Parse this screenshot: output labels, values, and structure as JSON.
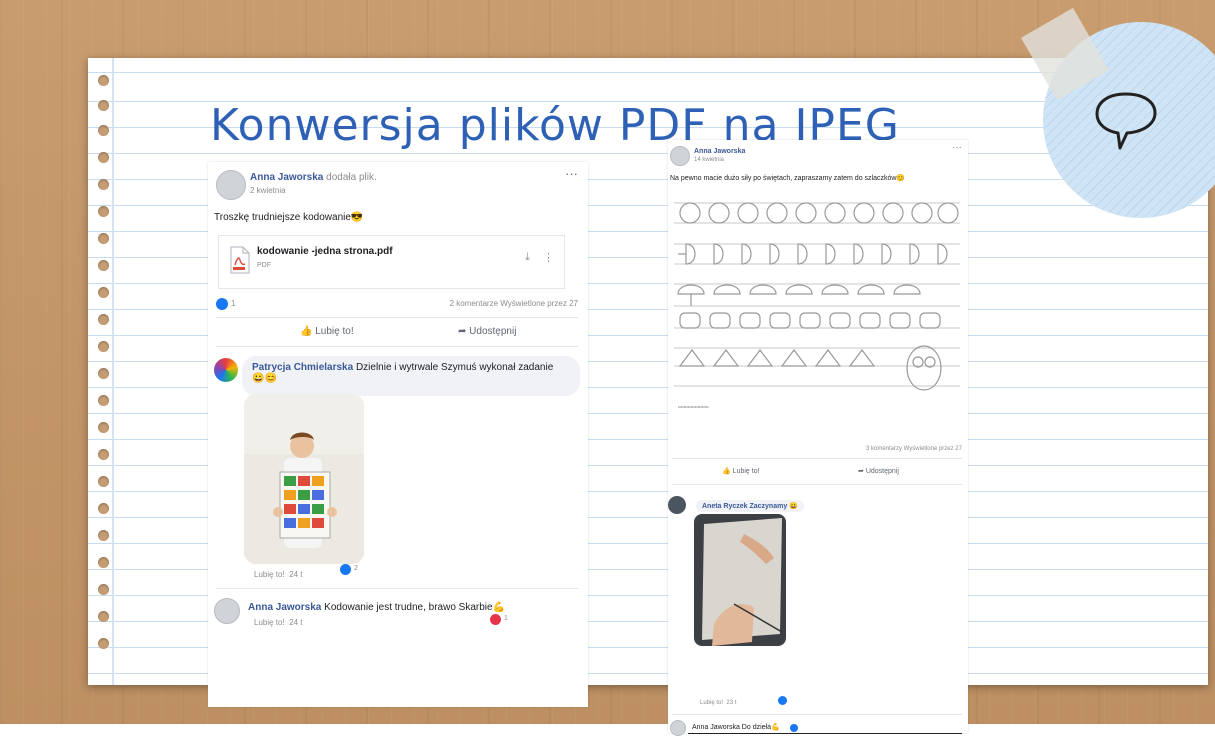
{
  "title": "Konwersja plików PDF na JPEG",
  "left_post": {
    "author": "Anna Jaworska",
    "action": "dodała plik.",
    "date": "2 kwietnia",
    "text": "Troszkę trudniejsze kodowanie😎",
    "file_name": "kodowanie -jedna strona.pdf",
    "file_type": "PDF",
    "reactions_count": "1",
    "stats": "2 komentarze  Wyświetlone przez 27",
    "like_label": "Lubię to!",
    "share_label": "Udostępnij",
    "comment1_author": "Patrycja Chmielarska",
    "comment1_text": "Dzielnie i wytrwale Szymuś wykonał zadanie",
    "comment1_emoji": "😀😊",
    "comment1_like": "Lubię to!",
    "comment1_time": "24 t",
    "comment1_reactions": "2",
    "comment2_author": "Anna Jaworska",
    "comment2_text": "Kodowanie jest trudne, brawo Skarbie💪",
    "comment2_like": "Lubię to!",
    "comment2_time": "24 t",
    "comment2_reactions": "1"
  },
  "right_post": {
    "author": "Anna Jaworska",
    "date": "14 kwietnia",
    "text": "Na pewno macie dużo siły po świętach, zapraszamy zatem do szlaczków😊",
    "stats": "3 komentarzy  Wyświetlone przez 27",
    "like_label": "Lubię to!",
    "share_label": "Udostępnij",
    "comment1_author": "Aneta Ryczek Zaczynamy",
    "comment1_emoji": "😀",
    "comment1_like": "Lubię to!",
    "comment1_time": "23 t",
    "comment2_text": "Anna Jaworska Do dzieła💪"
  },
  "colors": {
    "title": "#2e61b6",
    "link_name": "#3b5998",
    "like_blue": "#1877f2",
    "heart_red": "#e8344b"
  },
  "icons": [
    "speech-bubble-icon",
    "pdf-file-icon",
    "like-icon",
    "share-icon",
    "more-options-icon",
    "download-icon"
  ]
}
